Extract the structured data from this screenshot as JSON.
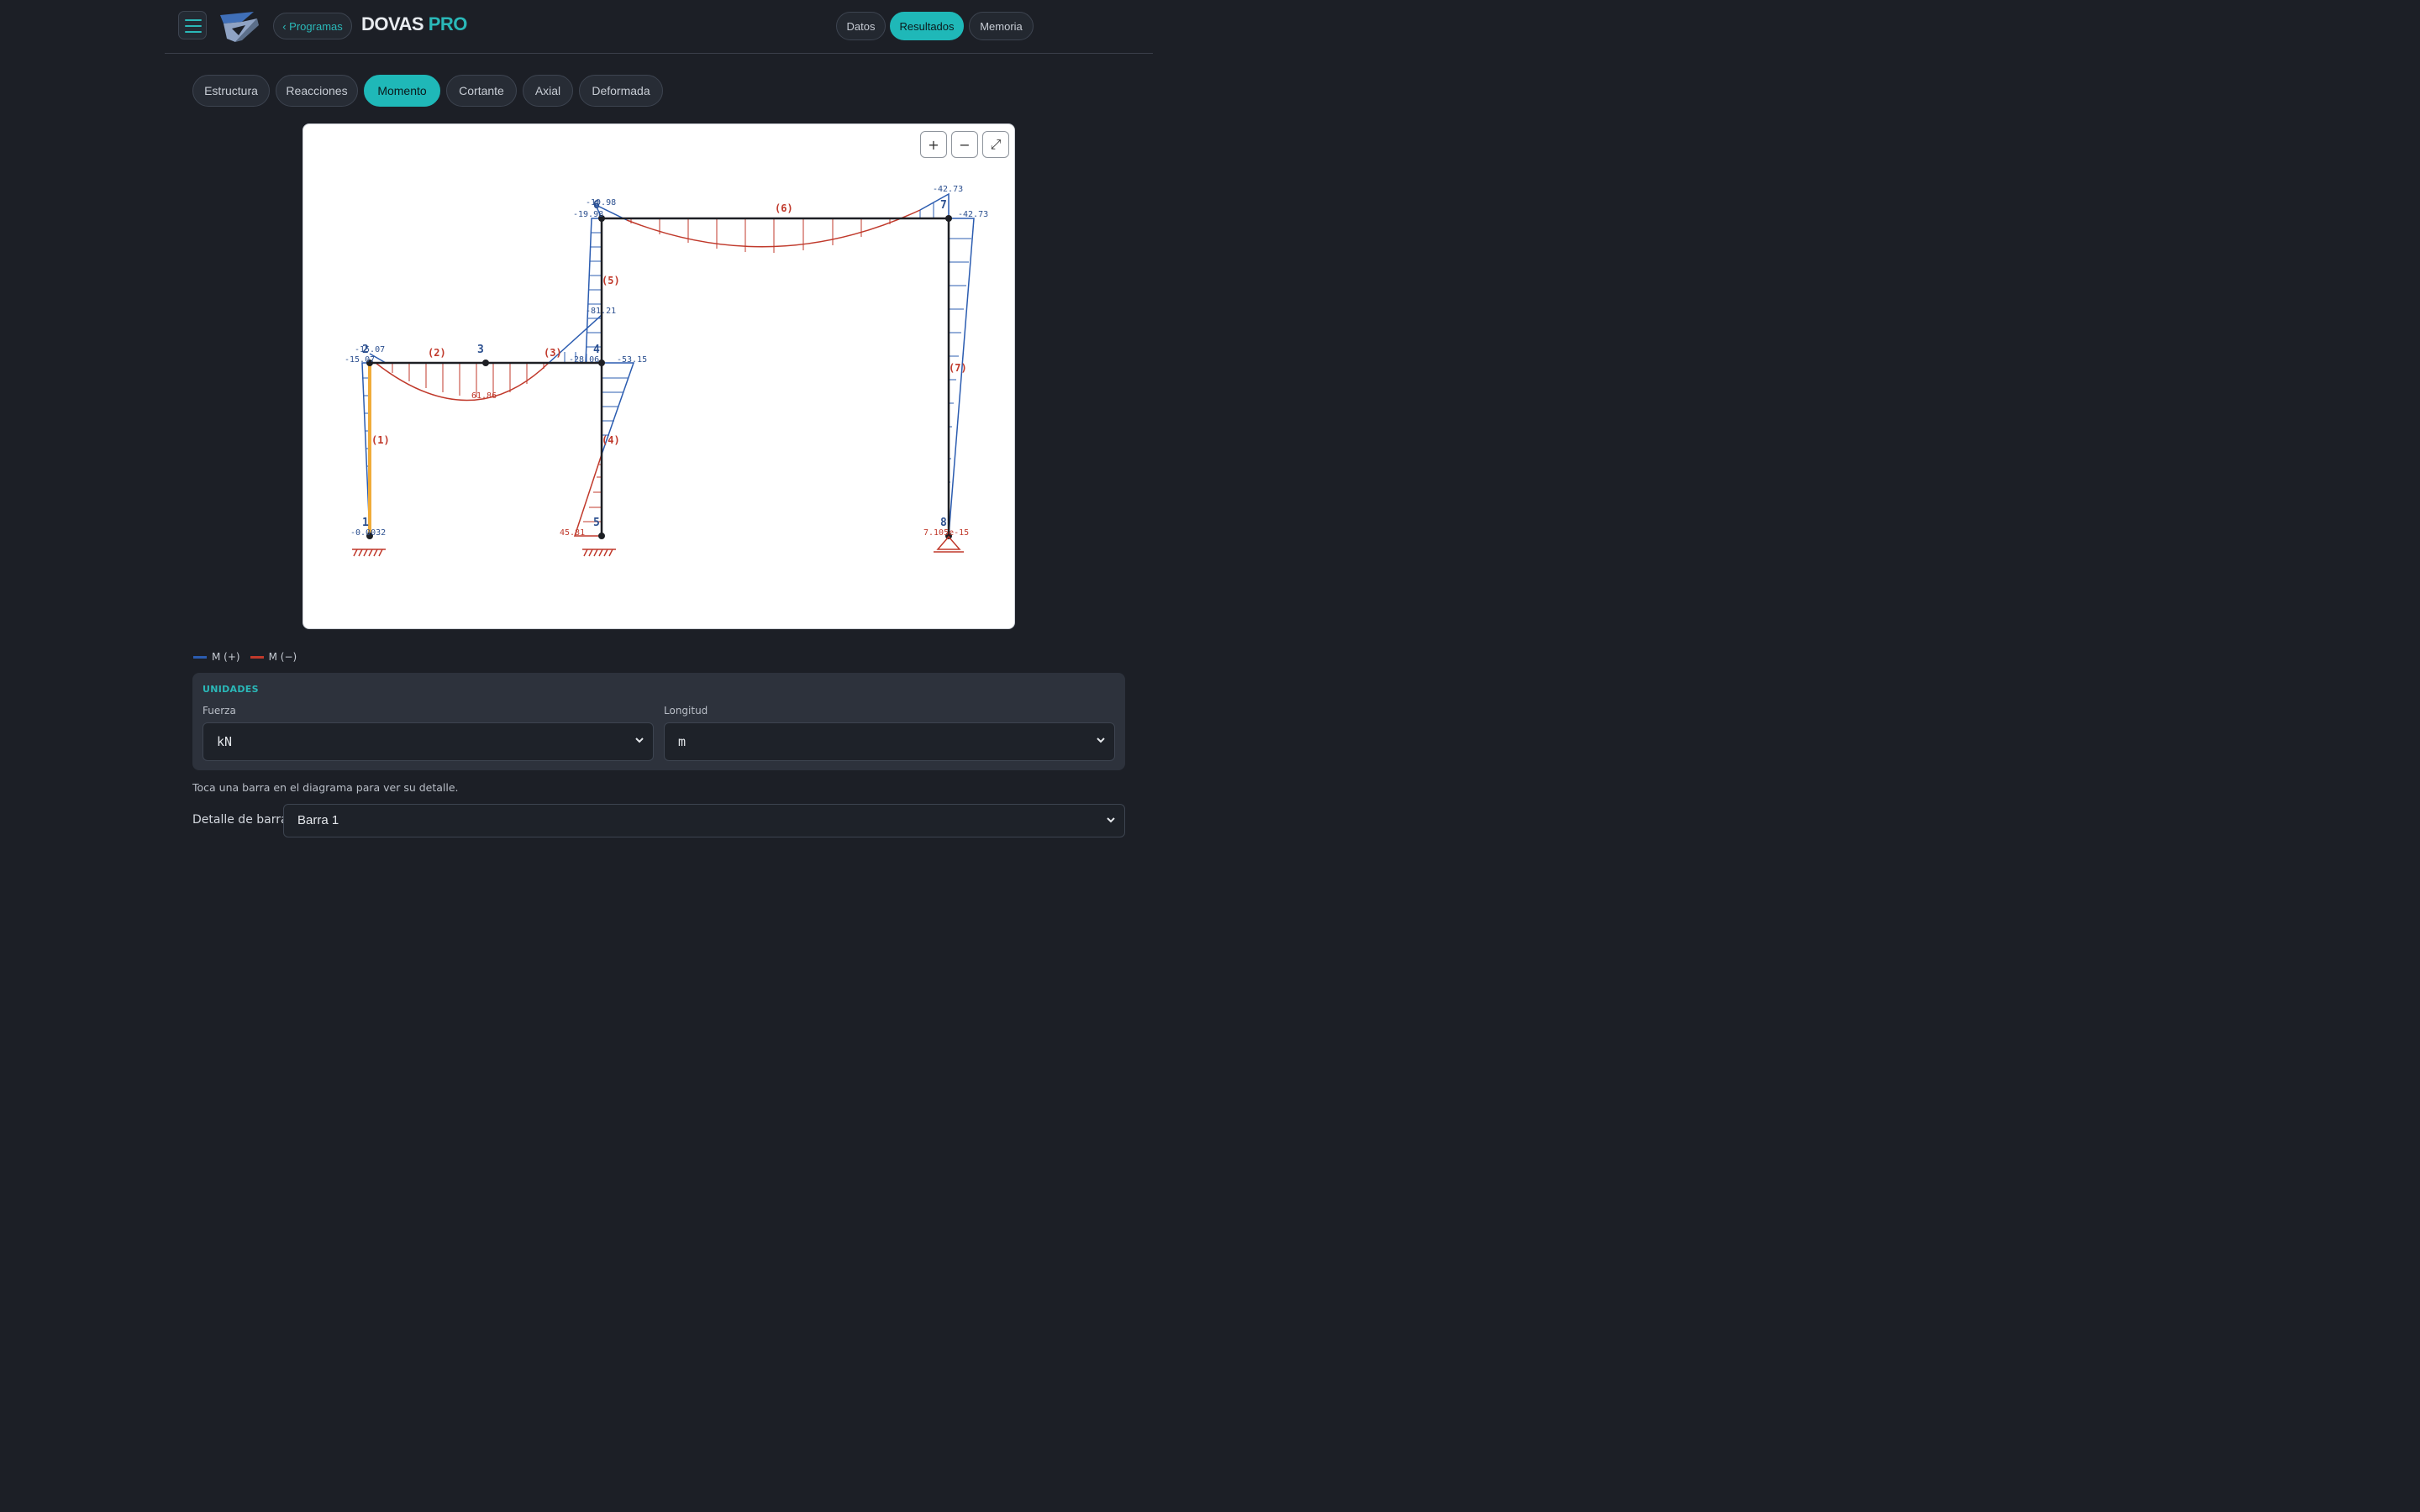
{
  "header": {
    "back_label": "‹ Programas",
    "brand_main": "DOVAS",
    "brand_accent": "PRO",
    "nav": [
      {
        "label": "Datos",
        "active": false
      },
      {
        "label": "Resultados",
        "active": true
      },
      {
        "label": "Memoria",
        "active": false
      }
    ]
  },
  "tabs": [
    {
      "label": "Estructura",
      "active": false
    },
    {
      "label": "Reacciones",
      "active": false
    },
    {
      "label": "Momento",
      "active": true
    },
    {
      "label": "Cortante",
      "active": false
    },
    {
      "label": "Axial",
      "active": false
    },
    {
      "label": "Deformada",
      "active": false
    }
  ],
  "zoom": {
    "in": "+",
    "out": "−",
    "fit": "⤢"
  },
  "diagram": {
    "nodes": [
      "1",
      "2",
      "3",
      "4",
      "5",
      "6",
      "7",
      "8"
    ],
    "bars": [
      "(1)",
      "(2)",
      "(3)",
      "(4)",
      "(5)",
      "(6)",
      "(7)"
    ],
    "values": [
      "-15.07",
      "-15.07",
      "61.86",
      "-28.06",
      "-53.15",
      "-81.21",
      "-19.98",
      "-19.98",
      "-42.73",
      "-42.73",
      "-0.0032",
      "45.81",
      "7.105e-15"
    ]
  },
  "legend": [
    {
      "label": "M (+)",
      "color": "#2b5cb0"
    },
    {
      "label": "M (−)",
      "color": "#c0392b"
    }
  ],
  "units": {
    "title": "UNIDADES",
    "force_label": "Fuerza",
    "force_value": "kN",
    "length_label": "Longitud",
    "length_value": "m"
  },
  "hint": "Toca una barra en el diagrama para ver su detalle.",
  "detail": {
    "label": "Detalle de barra:",
    "value": "Barra 1"
  },
  "colors": {
    "accent": "#1fb8b8",
    "positive": "#2b5cb0",
    "negative": "#c0392b",
    "highlight": "#f0ac3a"
  }
}
